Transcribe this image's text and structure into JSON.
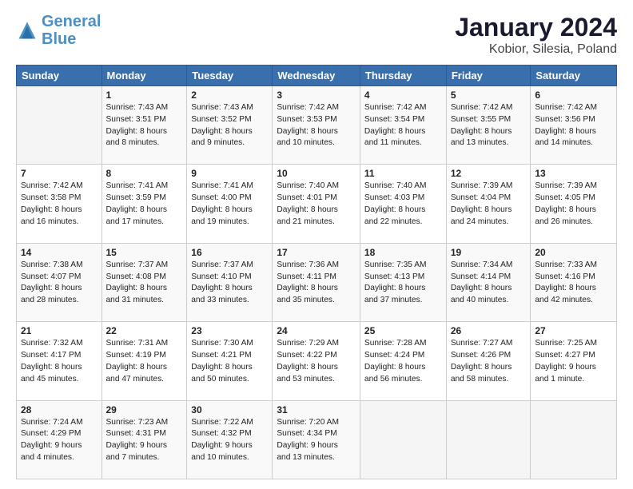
{
  "header": {
    "logo_general": "General",
    "logo_blue": "Blue",
    "title": "January 2024",
    "subtitle": "Kobior, Silesia, Poland"
  },
  "calendar": {
    "days_of_week": [
      "Sunday",
      "Monday",
      "Tuesday",
      "Wednesday",
      "Thursday",
      "Friday",
      "Saturday"
    ],
    "weeks": [
      [
        {
          "day": "",
          "info": ""
        },
        {
          "day": "1",
          "info": "Sunrise: 7:43 AM\nSunset: 3:51 PM\nDaylight: 8 hours\nand 8 minutes."
        },
        {
          "day": "2",
          "info": "Sunrise: 7:43 AM\nSunset: 3:52 PM\nDaylight: 8 hours\nand 9 minutes."
        },
        {
          "day": "3",
          "info": "Sunrise: 7:42 AM\nSunset: 3:53 PM\nDaylight: 8 hours\nand 10 minutes."
        },
        {
          "day": "4",
          "info": "Sunrise: 7:42 AM\nSunset: 3:54 PM\nDaylight: 8 hours\nand 11 minutes."
        },
        {
          "day": "5",
          "info": "Sunrise: 7:42 AM\nSunset: 3:55 PM\nDaylight: 8 hours\nand 13 minutes."
        },
        {
          "day": "6",
          "info": "Sunrise: 7:42 AM\nSunset: 3:56 PM\nDaylight: 8 hours\nand 14 minutes."
        }
      ],
      [
        {
          "day": "7",
          "info": "Sunrise: 7:42 AM\nSunset: 3:58 PM\nDaylight: 8 hours\nand 16 minutes."
        },
        {
          "day": "8",
          "info": "Sunrise: 7:41 AM\nSunset: 3:59 PM\nDaylight: 8 hours\nand 17 minutes."
        },
        {
          "day": "9",
          "info": "Sunrise: 7:41 AM\nSunset: 4:00 PM\nDaylight: 8 hours\nand 19 minutes."
        },
        {
          "day": "10",
          "info": "Sunrise: 7:40 AM\nSunset: 4:01 PM\nDaylight: 8 hours\nand 21 minutes."
        },
        {
          "day": "11",
          "info": "Sunrise: 7:40 AM\nSunset: 4:03 PM\nDaylight: 8 hours\nand 22 minutes."
        },
        {
          "day": "12",
          "info": "Sunrise: 7:39 AM\nSunset: 4:04 PM\nDaylight: 8 hours\nand 24 minutes."
        },
        {
          "day": "13",
          "info": "Sunrise: 7:39 AM\nSunset: 4:05 PM\nDaylight: 8 hours\nand 26 minutes."
        }
      ],
      [
        {
          "day": "14",
          "info": "Sunrise: 7:38 AM\nSunset: 4:07 PM\nDaylight: 8 hours\nand 28 minutes."
        },
        {
          "day": "15",
          "info": "Sunrise: 7:37 AM\nSunset: 4:08 PM\nDaylight: 8 hours\nand 31 minutes."
        },
        {
          "day": "16",
          "info": "Sunrise: 7:37 AM\nSunset: 4:10 PM\nDaylight: 8 hours\nand 33 minutes."
        },
        {
          "day": "17",
          "info": "Sunrise: 7:36 AM\nSunset: 4:11 PM\nDaylight: 8 hours\nand 35 minutes."
        },
        {
          "day": "18",
          "info": "Sunrise: 7:35 AM\nSunset: 4:13 PM\nDaylight: 8 hours\nand 37 minutes."
        },
        {
          "day": "19",
          "info": "Sunrise: 7:34 AM\nSunset: 4:14 PM\nDaylight: 8 hours\nand 40 minutes."
        },
        {
          "day": "20",
          "info": "Sunrise: 7:33 AM\nSunset: 4:16 PM\nDaylight: 8 hours\nand 42 minutes."
        }
      ],
      [
        {
          "day": "21",
          "info": "Sunrise: 7:32 AM\nSunset: 4:17 PM\nDaylight: 8 hours\nand 45 minutes."
        },
        {
          "day": "22",
          "info": "Sunrise: 7:31 AM\nSunset: 4:19 PM\nDaylight: 8 hours\nand 47 minutes."
        },
        {
          "day": "23",
          "info": "Sunrise: 7:30 AM\nSunset: 4:21 PM\nDaylight: 8 hours\nand 50 minutes."
        },
        {
          "day": "24",
          "info": "Sunrise: 7:29 AM\nSunset: 4:22 PM\nDaylight: 8 hours\nand 53 minutes."
        },
        {
          "day": "25",
          "info": "Sunrise: 7:28 AM\nSunset: 4:24 PM\nDaylight: 8 hours\nand 56 minutes."
        },
        {
          "day": "26",
          "info": "Sunrise: 7:27 AM\nSunset: 4:26 PM\nDaylight: 8 hours\nand 58 minutes."
        },
        {
          "day": "27",
          "info": "Sunrise: 7:25 AM\nSunset: 4:27 PM\nDaylight: 9 hours\nand 1 minute."
        }
      ],
      [
        {
          "day": "28",
          "info": "Sunrise: 7:24 AM\nSunset: 4:29 PM\nDaylight: 9 hours\nand 4 minutes."
        },
        {
          "day": "29",
          "info": "Sunrise: 7:23 AM\nSunset: 4:31 PM\nDaylight: 9 hours\nand 7 minutes."
        },
        {
          "day": "30",
          "info": "Sunrise: 7:22 AM\nSunset: 4:32 PM\nDaylight: 9 hours\nand 10 minutes."
        },
        {
          "day": "31",
          "info": "Sunrise: 7:20 AM\nSunset: 4:34 PM\nDaylight: 9 hours\nand 13 minutes."
        },
        {
          "day": "",
          "info": ""
        },
        {
          "day": "",
          "info": ""
        },
        {
          "day": "",
          "info": ""
        }
      ]
    ]
  }
}
